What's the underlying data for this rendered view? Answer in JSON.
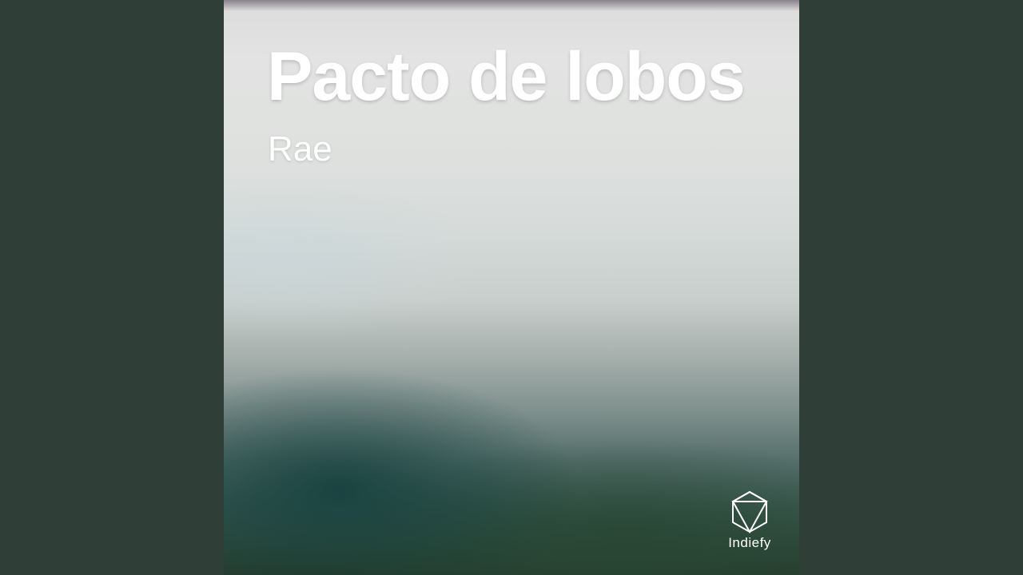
{
  "cover": {
    "title": "Pacto de lobos",
    "artist": "Rae",
    "brand": {
      "name": "Indiefy",
      "icon": "indiefy-logo-icon"
    }
  },
  "colors": {
    "side_background": "#2f3e36",
    "text": "#ffffff"
  }
}
